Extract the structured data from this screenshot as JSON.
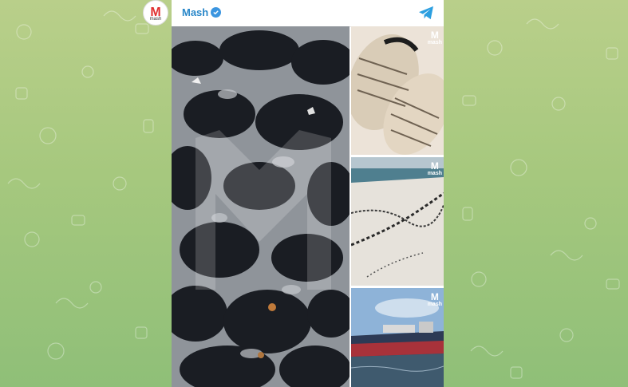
{
  "header": {
    "channel_name": "Mash",
    "avatar_letter": "M",
    "avatar_sub": "mash"
  },
  "icons": {
    "verified": "verified-icon",
    "send": "telegram-send-icon"
  },
  "colors": {
    "channel_name": "#2a87c9",
    "verified": "#3b95e0",
    "brand_red": "#e0302f"
  },
  "watermark": {
    "letter": "M",
    "text": "mash"
  }
}
